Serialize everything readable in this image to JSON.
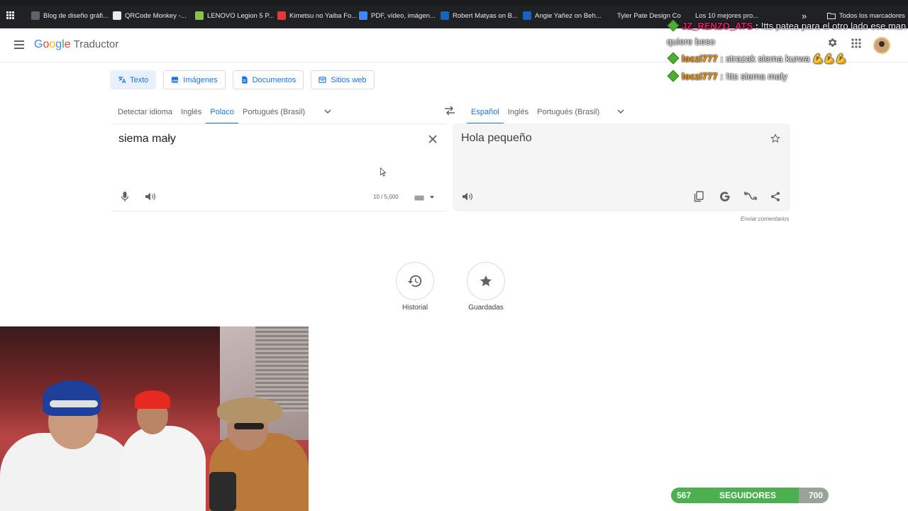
{
  "bookmarks": [
    {
      "label": "Blog de diseño gráfi...",
      "color": "#5f6368"
    },
    {
      "label": "QRCode Monkey -...",
      "color": "#e8eaed"
    },
    {
      "label": "LENOVO Legion 5 P...",
      "color": "#8bc34a"
    },
    {
      "label": "Kimetsu no Yaiba Fo...",
      "color": "#e53935"
    },
    {
      "label": "PDF, vídeo, imágen...",
      "color": "#4285f4"
    },
    {
      "label": "Robert Matyas on B...",
      "color": "#1565c0"
    },
    {
      "label": "Angie Yañez on Beh...",
      "color": "#1565c0"
    },
    {
      "label": "Tyler Pate Design Co",
      "color": "#202124"
    },
    {
      "label": "Los 10 mejores pro...",
      "color": "#202124"
    }
  ],
  "bookmarks_more": "»",
  "bookmarks_all": "Todos los marcadores",
  "app": {
    "logo_google": "Google",
    "logo_product": "Traductor"
  },
  "modes": [
    {
      "label": "Texto",
      "icon": "translate-icon",
      "active": true
    },
    {
      "label": "Imágenes",
      "icon": "image-icon",
      "active": false
    },
    {
      "label": "Documentos",
      "icon": "document-icon",
      "active": false
    },
    {
      "label": "Sitios web",
      "icon": "web-icon",
      "active": false
    }
  ],
  "source_langs": [
    "Detectar idioma",
    "Inglés",
    "Polaco",
    "Portugués (Brasil)"
  ],
  "source_active": "Polaco",
  "target_langs": [
    "Español",
    "Inglés",
    "Portugués (Brasil)"
  ],
  "target_active": "Español",
  "source": {
    "text": "siema mały",
    "counter": "10 / 5,000"
  },
  "target": {
    "text": "Hola pequeño",
    "feedback": "Enviar comentarios"
  },
  "history": {
    "historial": "Historial",
    "guardadas": "Guardadas"
  },
  "chat": [
    {
      "user": "JZ_RENZO_ATS",
      "user_color": "#e91e63",
      "msg": "!tts patea para el otro lado ese man quiere beso"
    },
    {
      "user": "loczi777",
      "user_color": "#ff9800",
      "msg": "strazak siema kurwa 💪💪💪"
    },
    {
      "user": "loczi777",
      "user_color": "#ff9800",
      "msg": "!tts siema mały"
    }
  ],
  "followers": {
    "current": "567",
    "label": "SEGUIDORES",
    "goal": "700",
    "progress": 0.81
  },
  "colors": {
    "accent": "#1a73e8",
    "chat_green": "#4caf50"
  }
}
